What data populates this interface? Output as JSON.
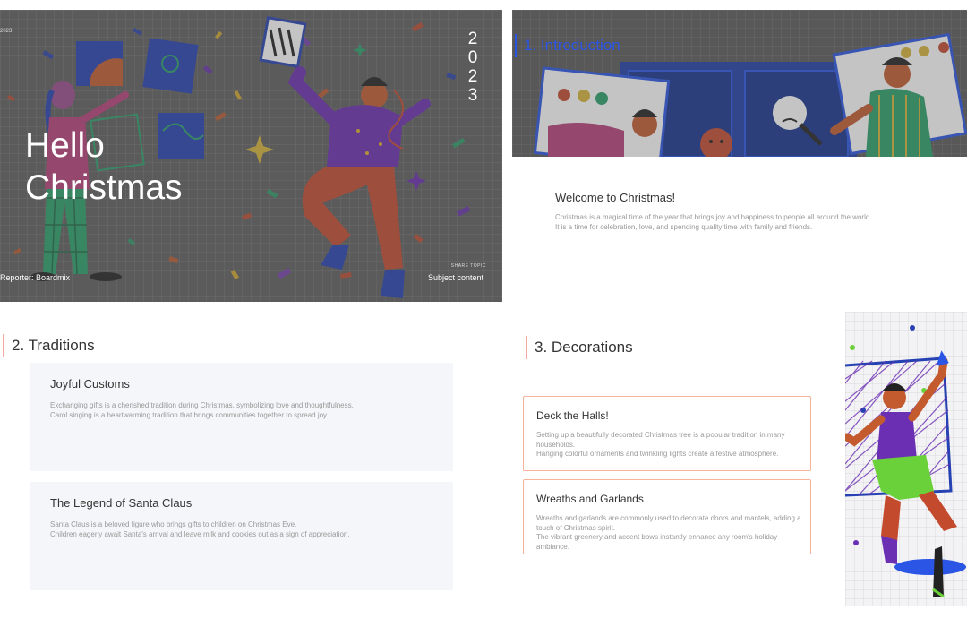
{
  "cover": {
    "date_small": "2023",
    "title_line1": "Hello",
    "title_line2": "Christmas",
    "year_digits": [
      "2",
      "0",
      "2",
      "3"
    ],
    "reporter": "Reporter: Boardmix",
    "share_topic": "SHARE TOPIC",
    "subject": "Subject content"
  },
  "intro": {
    "heading": "1. Introduction",
    "welcome_title": "Welcome to Christmas!",
    "welcome_line1": "Christmas is a magical time of the year that brings joy and happiness to people all around the world.",
    "welcome_line2": "It is a time for celebration, love, and spending quality time with family and friends."
  },
  "traditions": {
    "heading": "2. Traditions",
    "cards": [
      {
        "title": "Joyful Customs",
        "line1": "Exchanging gifts is a cherished tradition during Christmas, symbolizing love and thoughtfulness.",
        "line2": "Carol singing is a heartwarming tradition that brings communities together to spread joy."
      },
      {
        "title": "The Legend of Santa Claus",
        "line1": "Santa Claus is a beloved figure who brings gifts to children on Christmas Eve.",
        "line2": "Children eagerly await Santa's arrival and leave milk and cookies out as a sign of appreciation."
      }
    ]
  },
  "decorations": {
    "heading": "3. Decorations",
    "cards": [
      {
        "title": "Deck the Halls!",
        "line1": "Setting up a beautifully decorated Christmas tree is a popular tradition in many households.",
        "line2": "Hanging colorful ornaments and twinkling lights create a festive atmosphere."
      },
      {
        "title": "Wreaths and Garlands",
        "line1": "Wreaths and garlands are commonly used to decorate doors and mantels, adding a touch of Christmas spirit.",
        "line2": "The vibrant greenery and accent bows instantly enhance any room's holiday ambiance."
      }
    ]
  },
  "colors": {
    "accent_blue": "#2a55e5",
    "accent_salmon": "#f2a7a0",
    "card_border": "#f5b39a",
    "cover_bg": "#5f5f5f"
  }
}
